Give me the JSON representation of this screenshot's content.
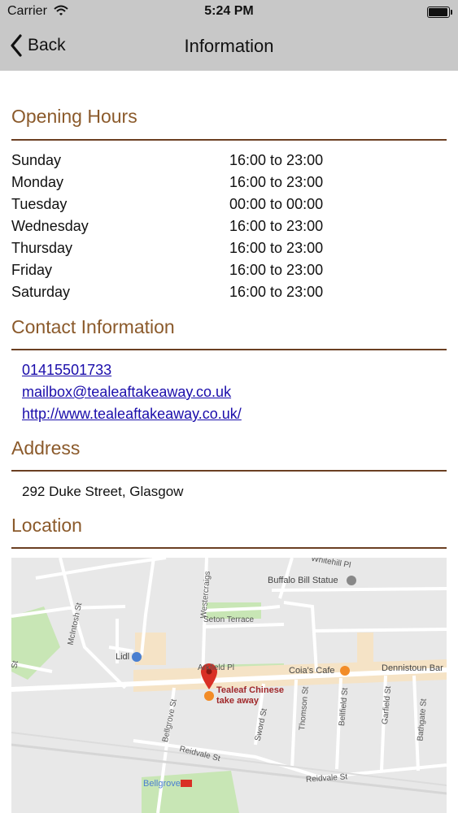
{
  "status_bar": {
    "carrier": "Carrier",
    "time": "5:24 PM",
    "battery_level": 0.95
  },
  "nav": {
    "back_label": "Back",
    "title": "Information"
  },
  "opening_hours": {
    "title": "Opening Hours",
    "rows": [
      {
        "day": "Sunday",
        "hours": "16:00 to 23:00"
      },
      {
        "day": "Monday",
        "hours": "16:00 to 23:00"
      },
      {
        "day": "Tuesday",
        "hours": "00:00 to 00:00"
      },
      {
        "day": "Wednesday",
        "hours": "16:00 to 23:00"
      },
      {
        "day": "Thursday",
        "hours": "16:00 to 23:00"
      },
      {
        "day": "Friday",
        "hours": "16:00 to 23:00"
      },
      {
        "day": "Saturday",
        "hours": "16:00 to 23:00"
      }
    ]
  },
  "contact": {
    "title": "Contact Information",
    "phone": "01415501733",
    "email": "mailbox@tealeaftakeaway.co.uk",
    "website": "http://www.tealeaftakeaway.co.uk/"
  },
  "address": {
    "title": "Address",
    "text": "292 Duke Street, Glasgow"
  },
  "location": {
    "title": "Location",
    "map": {
      "pin_label_line1": "Tealeaf Chinese",
      "pin_label_line2": "take away",
      "pois": {
        "buffalo": "Buffalo Bill Statue",
        "lidl": "Lidl",
        "coias": "Coia's Cafe",
        "dennistoun": "Dennistoun Bar",
        "bellgrove": "Bellgrove"
      },
      "streets": {
        "westercraigs": "Westercraigs",
        "mcintosh": "McIntosh St",
        "seton": "Seton Terrace",
        "ark": "Arkfield Pl",
        "bellgrove_st": "Bellgrove St",
        "sword": "Sword St",
        "thomson": "Thomson St",
        "bellfield": "Bellfield St",
        "garfield": "Garfield St",
        "bathgate": "Bathgate St",
        "reidvale1": "Reidvale St",
        "reidvale2": "Reidvale St",
        "whitehill": "Whitehill Pl",
        "left_st": "St"
      }
    }
  }
}
